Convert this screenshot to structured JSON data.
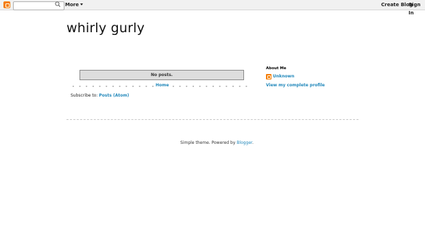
{
  "navbar": {
    "search_placeholder": "",
    "more_label": "More",
    "create_blog_label": "Create Blog",
    "sign_in_label": "Sign In"
  },
  "blog": {
    "title": "whirly gurly"
  },
  "main": {
    "no_posts": "No posts.",
    "home_link": "Home",
    "subscribe_label": "Subscribe to:",
    "subscribe_link": "Posts (Atom)"
  },
  "sidebar": {
    "about_heading": "About Me",
    "author_name": "Unknown",
    "profile_link": "View my complete profile"
  },
  "footer": {
    "text": "Simple theme. Powered by",
    "powered_link": "Blogger",
    "period": "."
  },
  "colors": {
    "link": "#2288bb",
    "blogger_orange": "#f57d00"
  }
}
